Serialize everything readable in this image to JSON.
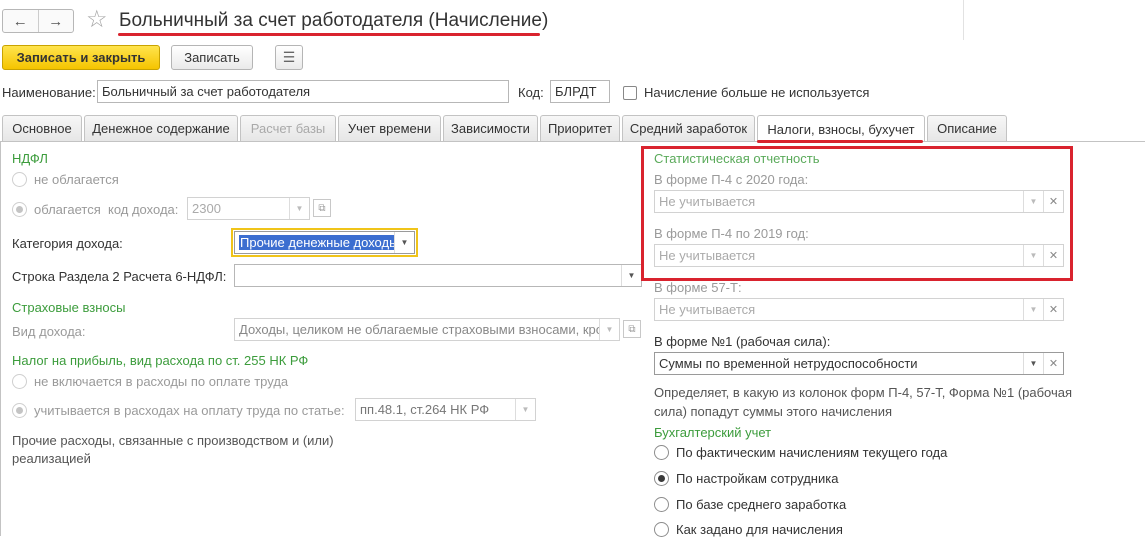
{
  "header": {
    "title": "Больничный за счет работодателя (Начисление)",
    "back_icon": "←",
    "forward_icon": "→",
    "star_icon": "☆"
  },
  "toolbar": {
    "save_close_label": "Записать и закрыть",
    "save_label": "Записать",
    "doc_icon": "☰"
  },
  "form": {
    "name_label": "Наименование:",
    "name_value": "Больничный за счет работодателя",
    "code_label": "Код:",
    "code_value": "БЛРДТ",
    "unused_label": "Начисление больше не используется"
  },
  "tabs": [
    {
      "label": "Основное"
    },
    {
      "label": "Денежное содержание"
    },
    {
      "label": "Расчет базы"
    },
    {
      "label": "Учет времени"
    },
    {
      "label": "Зависимости"
    },
    {
      "label": "Приоритет"
    },
    {
      "label": "Средний заработок"
    },
    {
      "label": "Налоги, взносы, бухучет"
    },
    {
      "label": "Описание"
    }
  ],
  "left": {
    "ndfl_title": "НДФЛ",
    "not_taxed": "не облагается",
    "taxed": "облагается",
    "income_code_label": "код дохода:",
    "income_code_value": "2300",
    "income_category_label": "Категория дохода:",
    "income_category_value": "Прочие денежные доходы",
    "row6_label": "Строка Раздела 2 Расчета 6-НДФЛ:",
    "row6_value": "",
    "insurance_title": "Страховые взносы",
    "income_type_label": "Вид дохода:",
    "income_type_value": "Доходы, целиком не облагаемые страховыми взносами, кроме пособий",
    "profit_tax_title": "Налог на прибыль, вид расхода по ст. 255 НК РФ",
    "not_included": "не включается в расходы по оплате труда",
    "included": "учитывается в расходах на оплату труда по статье:",
    "article_value": "пп.48.1, ст.264 НК РФ",
    "other_expenses": "Прочие расходы, связанные с производством и (или) реализацией"
  },
  "right": {
    "stat_title": "Статистическая отчетность",
    "p4_2020_label": "В форме П-4 с 2020 года:",
    "p4_2020_value": "Не учитывается",
    "p4_2019_label": "В форме П-4 по 2019 год:",
    "p4_2019_value": "Не учитывается",
    "f57_label": "В форме 57-Т:",
    "f57_value": "Не учитывается",
    "f1_label": "В форме №1 (рабочая сила):",
    "f1_value": "Суммы по временной нетрудоспособности",
    "description": "Определяет, в какую из колонок форм П-4, 57-Т, Форма №1 (рабочая сила) попадут суммы этого начисления",
    "accounting_title": "Бухгалтерский учет",
    "acc_options": [
      {
        "label": "По фактическим начислениям текущего года",
        "selected": false
      },
      {
        "label": "По настройкам сотрудника",
        "selected": true
      },
      {
        "label": "По базе среднего заработка",
        "selected": false
      },
      {
        "label": "Как задано для начисления",
        "selected": false
      }
    ]
  },
  "colors": {
    "accent_yellow": "#f5c400",
    "highlight_red": "#d9232e",
    "section_green": "#3c9c3c"
  }
}
